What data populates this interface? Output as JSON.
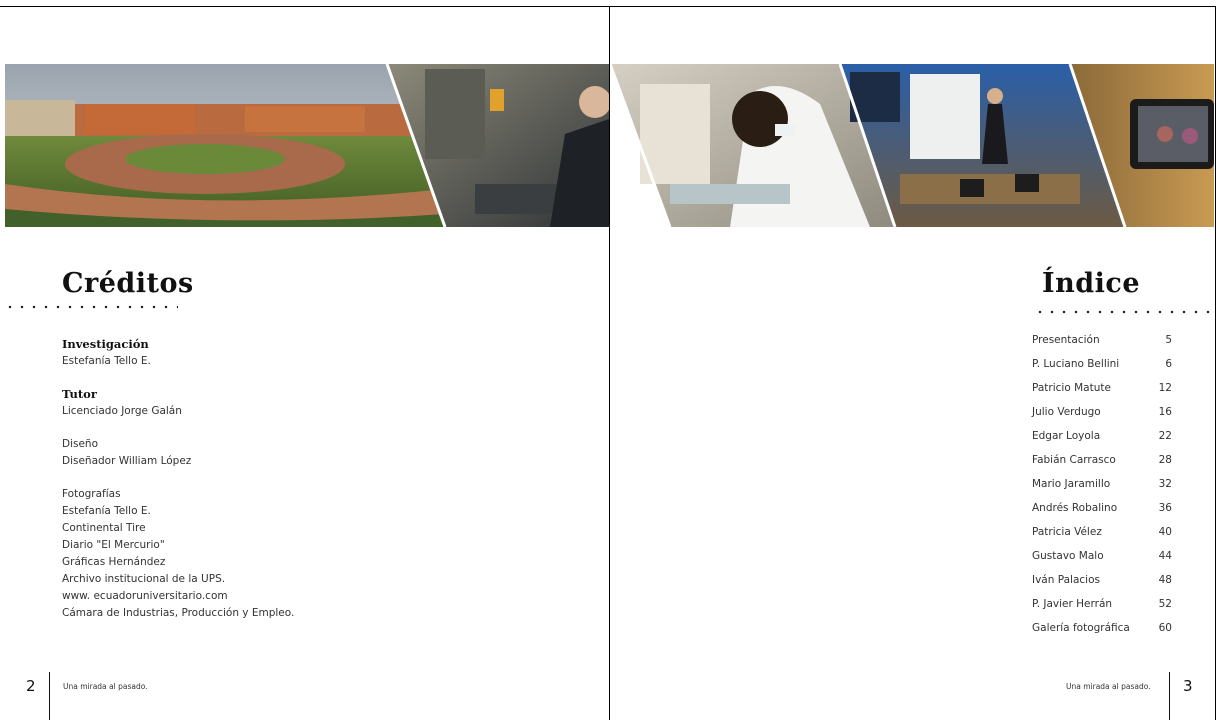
{
  "left_page": {
    "heading": "Créditos",
    "credits": [
      {
        "title": "Investigación",
        "bold": true,
        "lines": [
          "Estefanía Tello E."
        ]
      },
      {
        "title": "Tutor",
        "bold": true,
        "lines": [
          "Licenciado Jorge Galán"
        ]
      },
      {
        "title": "Diseño",
        "bold": false,
        "lines": [
          "Diseñador William López"
        ]
      },
      {
        "title": "Fotografías",
        "bold": false,
        "lines": [
          "Estefanía Tello E.",
          "Continental Tire",
          "Diario \"El Mercurio\"",
          "Gráficas Hernández",
          "Archivo institucional de la UPS.",
          "www. ecuadoruniversitario.com",
          "Cámara de Industrias, Producción y Empleo."
        ]
      }
    ],
    "page_number": "2",
    "footer_text": "Una mirada al pasado."
  },
  "right_page": {
    "heading": "Índice",
    "toc": [
      {
        "label": "Presentación",
        "page": "5"
      },
      {
        "label": "P. Luciano Bellini",
        "page": "6"
      },
      {
        "label": "Patricio Matute",
        "page": "12"
      },
      {
        "label": "Julio Verdugo",
        "page": "16"
      },
      {
        "label": "Edgar Loyola",
        "page": "22"
      },
      {
        "label": "Fabián Carrasco",
        "page": "28"
      },
      {
        "label": "Mario Jaramillo",
        "page": "32"
      },
      {
        "label": "Andrés Robalino",
        "page": "36"
      },
      {
        "label": "Patricia Vélez",
        "page": "40"
      },
      {
        "label": "Gustavo Malo",
        "page": "44"
      },
      {
        "label": "Iván Palacios",
        "page": "48"
      },
      {
        "label": "P. Javier Herrán",
        "page": "52"
      },
      {
        "label": "Galería fotográfica",
        "page": "60"
      }
    ],
    "page_number": "3",
    "footer_text": "Una mirada al pasado."
  },
  "photos": {
    "left": [
      "campus-panorama-photo",
      "workshop-lathe-photo"
    ],
    "right": [
      "laboratory-student-photo",
      "classroom-lecture-photo",
      "video-camera-photo"
    ]
  }
}
